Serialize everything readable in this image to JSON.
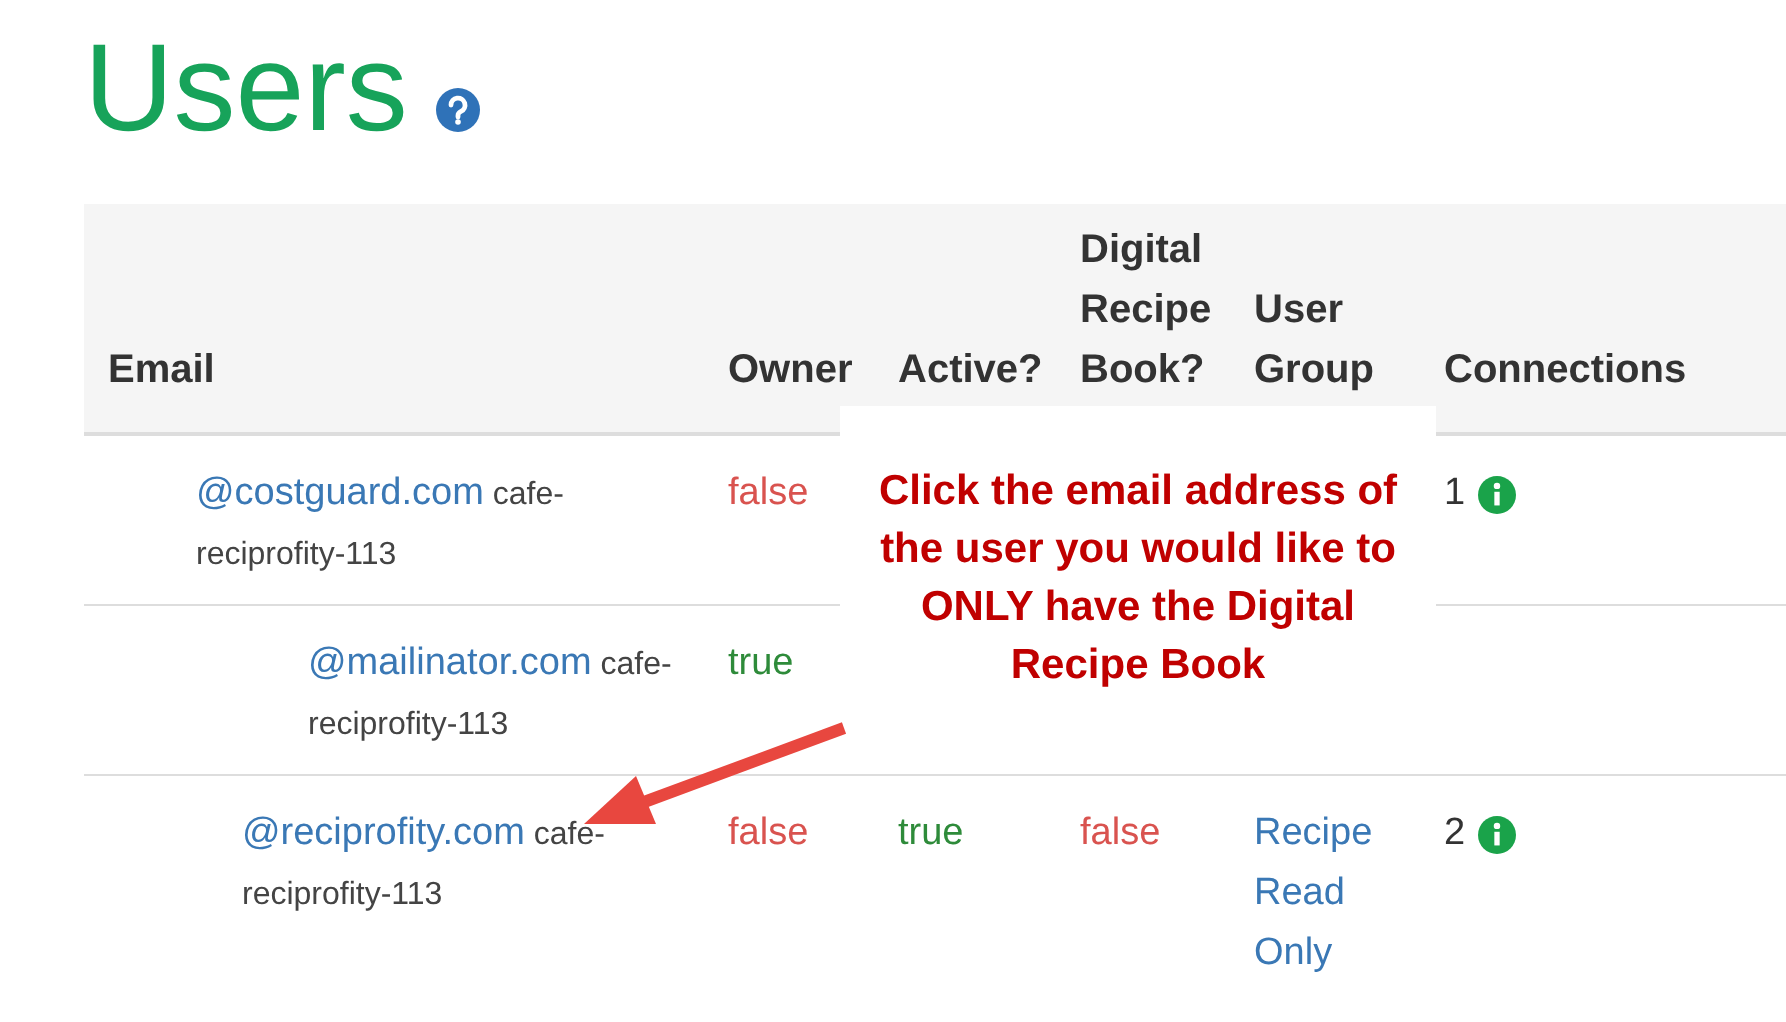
{
  "title": "Users",
  "table": {
    "columns": [
      "Email",
      "Owner",
      "Active?",
      "Digital Recipe Book?",
      "User Group",
      "Connections"
    ],
    "rows": [
      {
        "email": "@costguard.com",
        "group": "cafe-reciprofity-113",
        "owner": {
          "text": "false",
          "on": false
        },
        "connections": "1"
      },
      {
        "email": "@mailinator.com",
        "group": "cafe-reciprofity-113",
        "owner": {
          "text": "true",
          "on": true
        }
      },
      {
        "email": "@reciprofity.com",
        "group": "cafe-reciprofity-113",
        "owner": {
          "text": "false",
          "on": false
        },
        "active": {
          "text": "true",
          "on": true
        },
        "digital_recipe_book": {
          "text": "false",
          "on": false
        },
        "user_group": "Recipe Read Only",
        "connections": "2"
      }
    ]
  },
  "callout": {
    "text": "Click the email address of the user you would like to ONLY have the Digital Recipe Book"
  }
}
